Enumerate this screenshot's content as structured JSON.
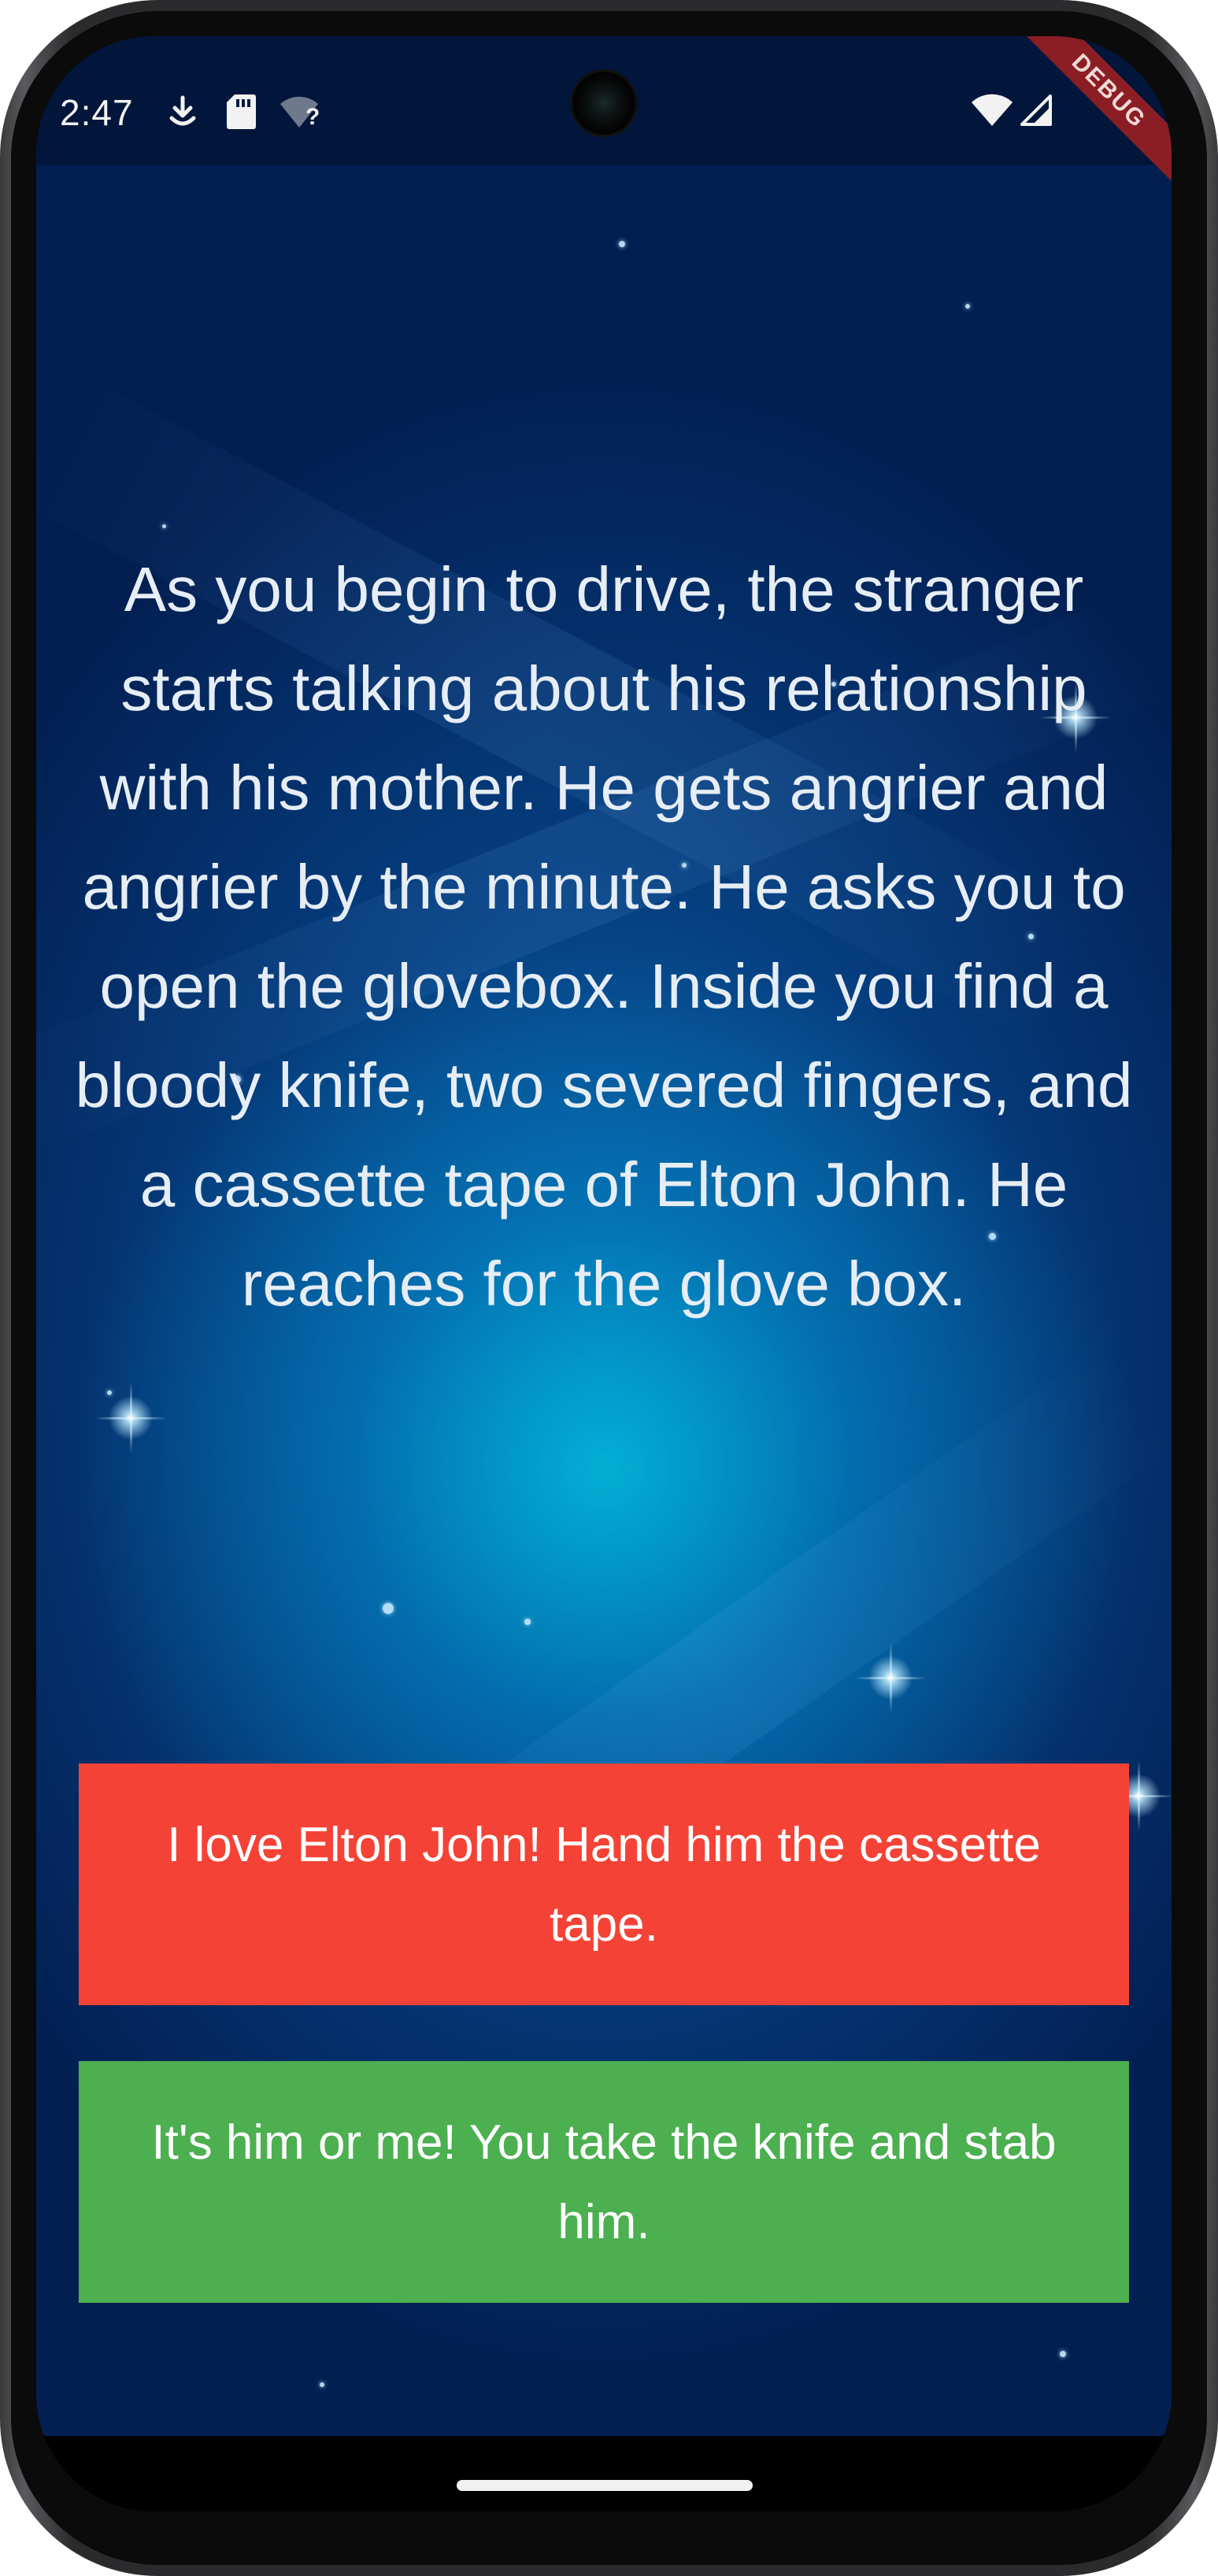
{
  "status_bar": {
    "time": "2:47",
    "left_icons": [
      "download-icon",
      "sd-card-icon",
      "wifi-unknown-icon"
    ],
    "wifi_unknown_mark": "?",
    "right_icons": [
      "wifi-icon",
      "cellular-signal-icon"
    ],
    "debug_label": "DEBUG"
  },
  "story": {
    "text": "As you begin to drive, the stranger starts talking about his relationship with his mother. He gets angrier and angrier by the minute. He asks you to open the glovebox. Inside you find a bloody knife, two severed fingers, and a cassette tape of Elton John. He reaches for the glove box."
  },
  "choices": [
    {
      "label": "I love Elton John! Hand him the cassette tape.",
      "color": "#f44336"
    },
    {
      "label": "It's him or me! You take the knife and stab him.",
      "color": "#4caf50"
    }
  ],
  "theme": {
    "background": "#031b49",
    "glow": "#00bedc",
    "text": "#e6edf4"
  }
}
